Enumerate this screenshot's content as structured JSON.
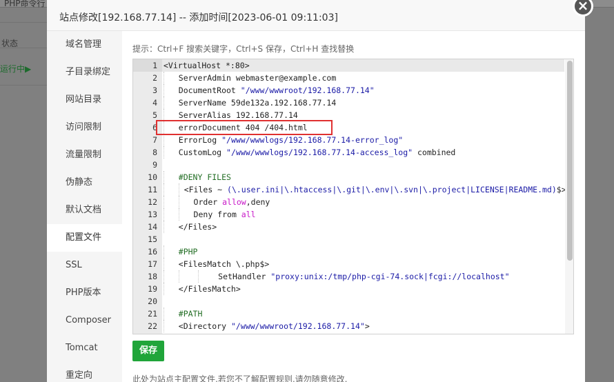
{
  "background": {
    "top_tabs": [
      "PHP命令行",
      "…",
      "…",
      "…"
    ],
    "status_label": "状态",
    "running_label": "运行中▶"
  },
  "dialog": {
    "title": "站点修改[192.168.77.14] -- 添加时间[2023-06-01 09:11:03]",
    "close_label": "×",
    "sidebar": [
      {
        "label": "域名管理",
        "active": false
      },
      {
        "label": "子目录绑定",
        "active": false
      },
      {
        "label": "网站目录",
        "active": false
      },
      {
        "label": "访问限制",
        "active": false
      },
      {
        "label": "流量限制",
        "active": false
      },
      {
        "label": "伪静态",
        "active": false
      },
      {
        "label": "默认文档",
        "active": false
      },
      {
        "label": "配置文件",
        "active": true
      },
      {
        "label": "SSL",
        "active": false
      },
      {
        "label": "PHP版本",
        "active": false
      },
      {
        "label": "Composer",
        "active": false
      },
      {
        "label": "Tomcat",
        "active": false
      },
      {
        "label": "重定向",
        "active": false
      }
    ],
    "hint": "提示：Ctrl+F 搜索关键字，Ctrl+S 保存，Ctrl+H 查找替换",
    "save_label": "保存",
    "note": "此处为站点主配置文件,若您不了解配置规则,请勿随意修改."
  },
  "editor": {
    "active_line": 1,
    "lines": [
      "<VirtualHost *:80>",
      "    ServerAdmin webmaster@example.com",
      "    DocumentRoot \"/www/wwwroot/192.168.77.14\"",
      "    ServerName 59de132a.192.168.77.14",
      "    ServerAlias 192.168.77.14",
      "    errorDocument 404 /404.html",
      "    ErrorLog \"/www/wwwlogs/192.168.77.14-error_log\"",
      "    CustomLog \"/www/wwwlogs/192.168.77.14-access_log\" combined",
      "",
      "    #DENY FILES",
      "     <Files ~ (\\.user.ini|\\.htaccess|\\.git|\\.env|\\.svn|\\.project|LICENSE|README.md)$>",
      "       Order allow,deny",
      "       Deny from all",
      "    </Files>",
      "",
      "    #PHP",
      "    <FilesMatch \\.php$>",
      "            SetHandler \"proxy:unix:/tmp/php-cgi-74.sock|fcgi://localhost\"",
      "    </FilesMatch>",
      "",
      "    #PATH",
      "    <Directory \"/www/wwwroot/192.168.77.14\">"
    ]
  },
  "colors": {
    "accent": "#20a53a",
    "highlight_border": "#e03030",
    "string": "#1a1aa6",
    "keyword": "#c817c8",
    "comment": "#236e25"
  }
}
